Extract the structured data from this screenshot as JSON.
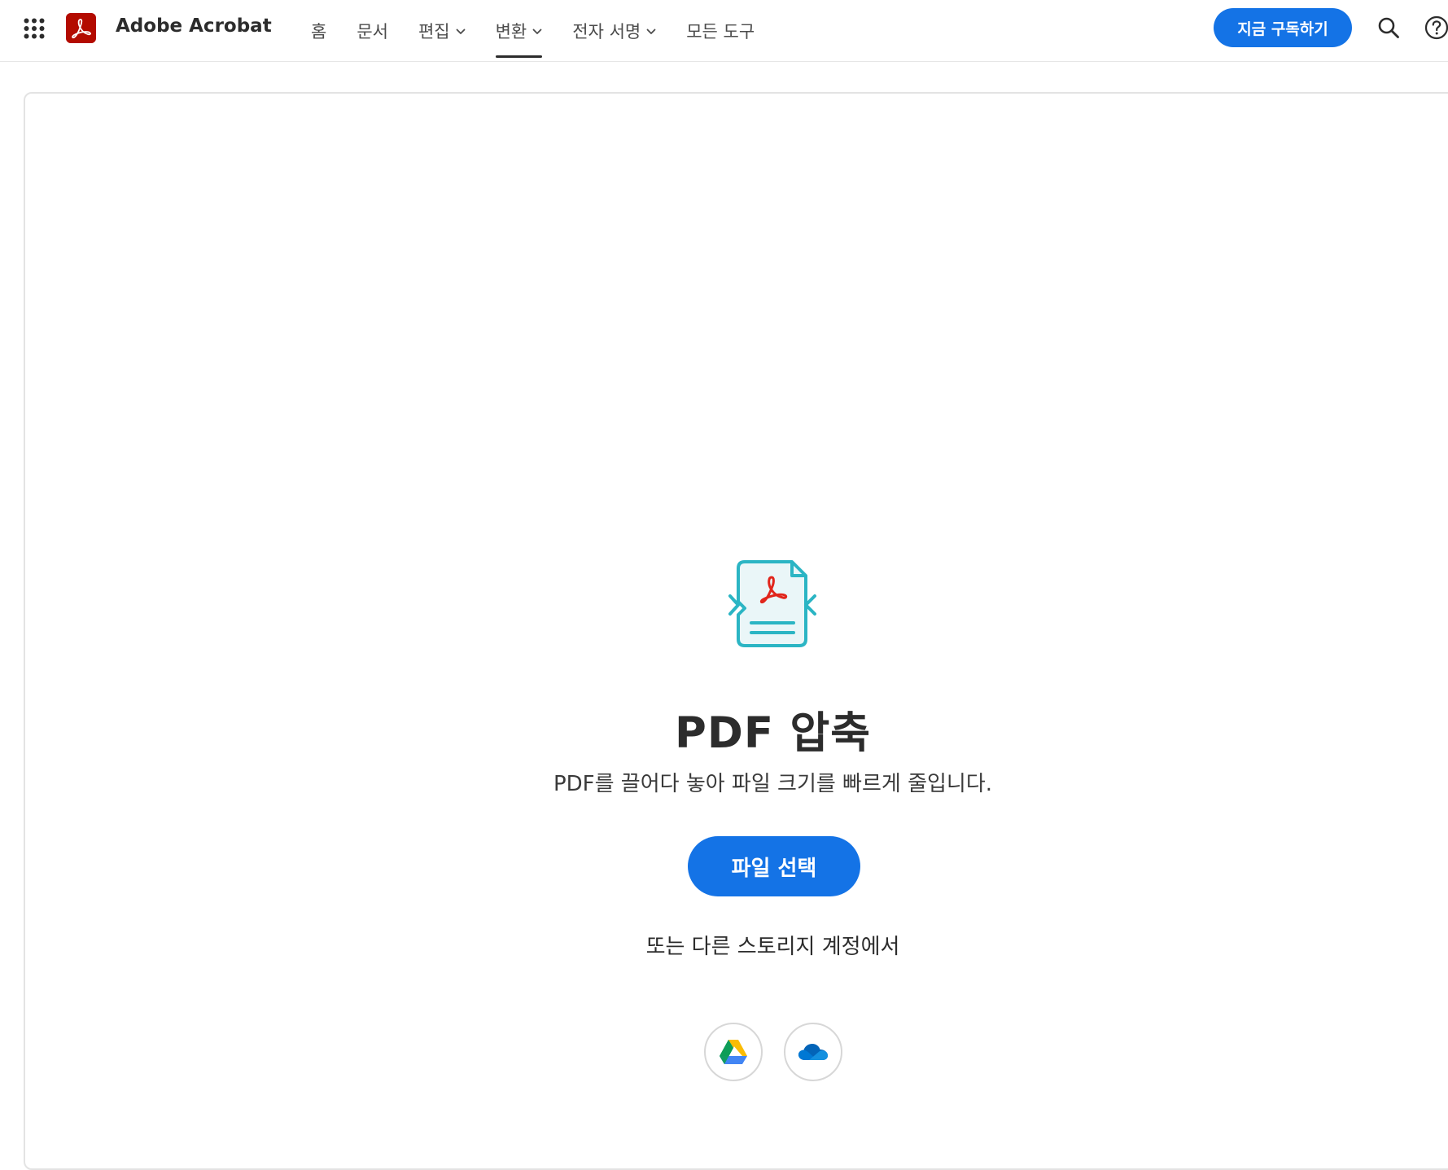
{
  "header": {
    "app_title": "Adobe Acrobat",
    "apps_icon": "app-grid-icon",
    "logo_icon": "acrobat-logo-icon",
    "nav": [
      {
        "label": "홈",
        "has_dropdown": false,
        "active": false
      },
      {
        "label": "문서",
        "has_dropdown": false,
        "active": false
      },
      {
        "label": "편집",
        "has_dropdown": true,
        "active": false
      },
      {
        "label": "변환",
        "has_dropdown": true,
        "active": true
      },
      {
        "label": "전자 서명",
        "has_dropdown": true,
        "active": false
      },
      {
        "label": "모든 도구",
        "has_dropdown": false,
        "active": false
      }
    ],
    "subscribe_label": "지금 구독하기",
    "search_icon": "search-icon",
    "help_icon": "help-icon"
  },
  "main": {
    "tool_icon": "compress-pdf-icon",
    "title": "PDF 압축",
    "description": "PDF를 끌어다 놓아 파일 크기를 빠르게 줄입니다.",
    "select_button_label": "파일 선택",
    "storage_text": "또는 다른 스토리지 계정에서",
    "storage_providers": [
      {
        "icon": "google-drive-icon"
      },
      {
        "icon": "onedrive-icon"
      }
    ]
  },
  "colors": {
    "accent": "#1473e6",
    "brand_red": "#b30b00",
    "teal": "#2bb5c4"
  }
}
